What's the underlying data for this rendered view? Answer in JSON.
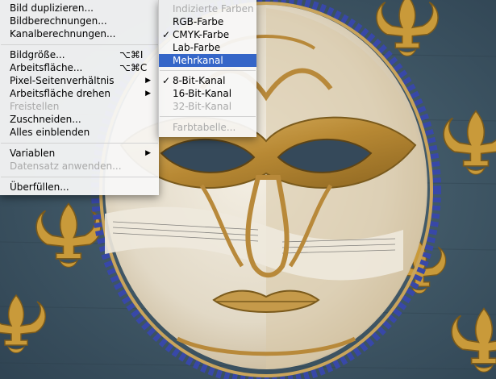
{
  "image_menu": {
    "items": [
      {
        "label": "Bild duplizieren...",
        "enabled": true
      },
      {
        "label": "Bildberechnungen...",
        "enabled": true
      },
      {
        "label": "Kanalberechnungen...",
        "enabled": true
      },
      {
        "label": "Bildgröße...",
        "shortcut": "⌥⌘I",
        "enabled": true
      },
      {
        "label": "Arbeitsfläche...",
        "shortcut": "⌥⌘C",
        "enabled": true
      },
      {
        "label": "Pixel-Seitenverhältnis",
        "submenu": true,
        "enabled": true
      },
      {
        "label": "Arbeitsfläche drehen",
        "submenu": true,
        "enabled": true
      },
      {
        "label": "Freistellen",
        "enabled": false
      },
      {
        "label": "Zuschneiden...",
        "enabled": true
      },
      {
        "label": "Alles einblenden",
        "enabled": true
      },
      {
        "label": "Variablen",
        "submenu": true,
        "enabled": true
      },
      {
        "label": "Datensatz anwenden...",
        "enabled": false
      },
      {
        "label": "Überfüllen...",
        "enabled": true
      }
    ],
    "submenu_arrow": "▶"
  },
  "mode_submenu": {
    "items": [
      {
        "label": "Indizierte Farben",
        "enabled": false,
        "checked": false
      },
      {
        "label": "RGB-Farbe",
        "enabled": true,
        "checked": false
      },
      {
        "label": "CMYK-Farbe",
        "enabled": true,
        "checked": true
      },
      {
        "label": "Lab-Farbe",
        "enabled": true,
        "checked": false
      },
      {
        "label": "Mehrkanal",
        "enabled": true,
        "checked": false,
        "selected": true
      },
      {
        "label": "8-Bit-Kanal",
        "enabled": true,
        "checked": true
      },
      {
        "label": "16-Bit-Kanal",
        "enabled": true,
        "checked": false
      },
      {
        "label": "32-Bit-Kanal",
        "enabled": false,
        "checked": false
      },
      {
        "label": "Farbtabelle...",
        "enabled": false,
        "checked": false
      }
    ],
    "check_mark": "✓",
    "highlight_color": "#3566c8"
  },
  "colors": {
    "fabric": "#3f5566",
    "fleur_gold": "#c99a3a",
    "mask_white": "#ece6d8",
    "mask_gold": "#b8893a",
    "rope_blue": "#3848a8"
  }
}
